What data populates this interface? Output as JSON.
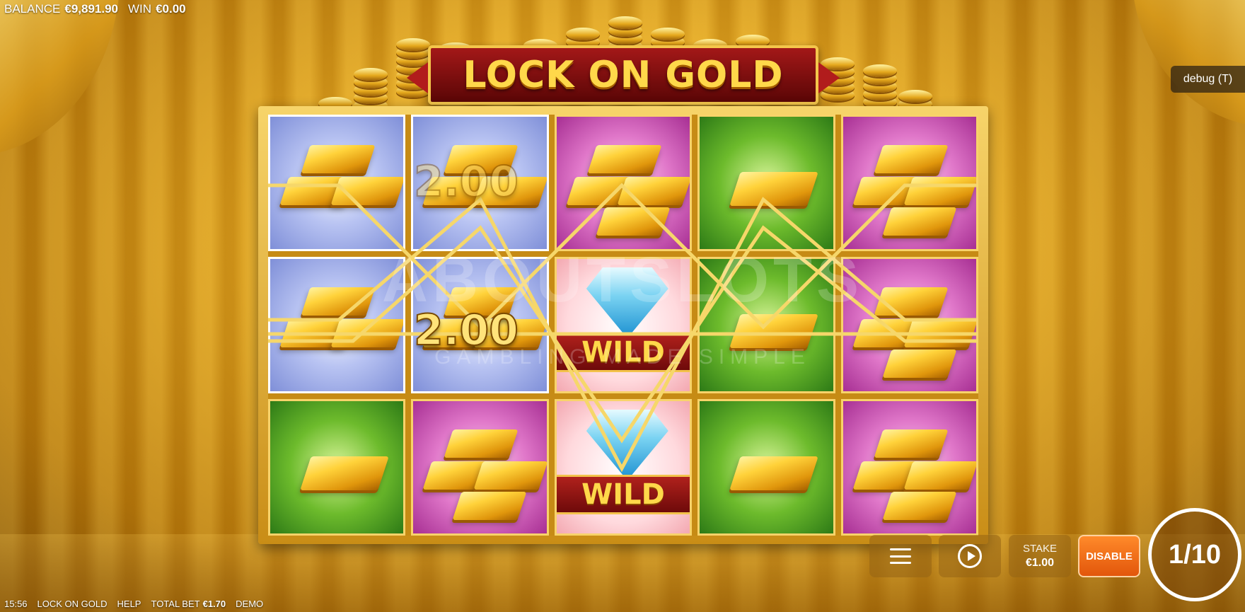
{
  "top_bar": {
    "balance_label": "BALANCE",
    "balance_value": "€9,891.90",
    "win_label": "WIN",
    "win_value": "€0.00"
  },
  "game_title": "LOCK ON GOLD",
  "debug_label": "debug (T)",
  "reels": [
    [
      "bars-stack",
      "bars-stack",
      "bar-single"
    ],
    [
      "bars-stack",
      "bars-stack",
      "bars-stack"
    ],
    [
      "bars-stack",
      "wild",
      "wild"
    ],
    [
      "bar-single",
      "bar-single",
      "bar-single"
    ],
    [
      "bars-stack",
      "bars-stack",
      "bars-stack"
    ]
  ],
  "wild_label": "WILD",
  "win_amounts": [
    "2.00",
    "2.00"
  ],
  "watermark": {
    "main": "ABOUTSLOTS",
    "sub": "GAMBLING MADE SIMPLE"
  },
  "controls": {
    "stake_label": "STAKE",
    "stake_value": "€1.00",
    "disable_label": "DISABLE",
    "spin_counter": "1/10"
  },
  "footer": {
    "time": "15:56",
    "game_name": "LOCK ON GOLD",
    "help": "HELP",
    "total_bet_label": "TOTAL BET",
    "total_bet_value": "€1.70",
    "mode": "DEMO"
  },
  "colors": {
    "accent_gold": "#ffd84a",
    "banner_red": "#a31818",
    "disable_orange": "#ff8a2a"
  }
}
